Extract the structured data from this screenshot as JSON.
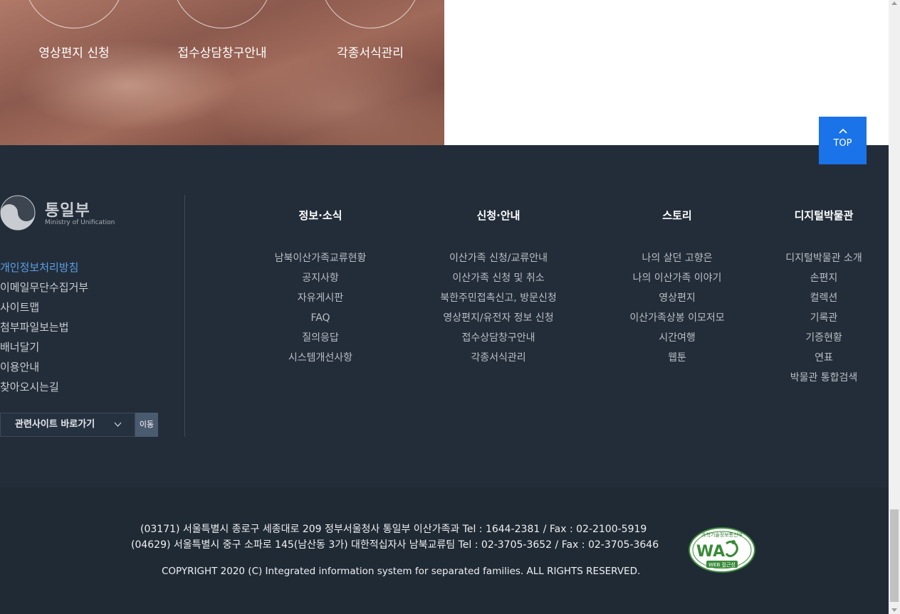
{
  "hero": {
    "items": [
      {
        "label": "영상편지 신청"
      },
      {
        "label": "접수상담창구안내"
      },
      {
        "label": "각종서식관리"
      }
    ]
  },
  "top_button": {
    "label": "TOP"
  },
  "logo": {
    "title_ko": "통일부",
    "title_en": "Ministry of Unification"
  },
  "left_links": [
    "개인정보처리방침",
    "이메일무단수집거부",
    "사이트맵",
    "첨부파일보는법",
    "배너달기",
    "이용안내",
    "찾아오시는길"
  ],
  "related": {
    "select_label": "관련사이트 바로가기",
    "go_label": "이동"
  },
  "columns": [
    {
      "title": "정보·소식",
      "items": [
        "남북이산가족교류현황",
        "공지사항",
        "자유게시판",
        "FAQ",
        "질의응답",
        "시스템개선사항"
      ]
    },
    {
      "title": "신청·안내",
      "items": [
        "이산가족 신청/교류안내",
        "이산가족 신청 및 취소",
        "북한주민접촉신고, 방문신청",
        "영상편지/유전자 정보 신청",
        "접수상담창구안내",
        "각종서식관리"
      ]
    },
    {
      "title": "스토리",
      "items": [
        "나의 살던 고향은",
        "나의 이산가족 이야기",
        "영상편지",
        "이산가족상봉 이모저모",
        "시간여행",
        "웹툰"
      ]
    },
    {
      "title": "디지털박물관",
      "items": [
        "디지털박물관 소개",
        "손편지",
        "컬렉션",
        "기록관",
        "기증현황",
        "연표",
        "박물관 통합검색"
      ]
    }
  ],
  "footer": {
    "address1": "(03171) 서울특별시 종로구 세종대로 209 정부서울청사 통일부 이산가족과 Tel : 1644-2381 / Fax : 02-2100-5919",
    "address2": "(04629) 서울특별시 중구 소파로 145(남산동 3가) 대한적십자사 남북교류팀 Tel : 02-3705-3652 / Fax : 02-3705-3646",
    "copyright": "COPYRIGHT 2020 (C) Integrated information system for separated families. ALL RIGHTS RESERVED.",
    "badge_top": "과학기술정보통신부",
    "badge_mark": "WA",
    "badge_bottom": "WEB 접근성"
  },
  "colors": {
    "footer_bg": "#232d39",
    "accent": "#1a73e8",
    "active_link": "#5aa0e6"
  }
}
